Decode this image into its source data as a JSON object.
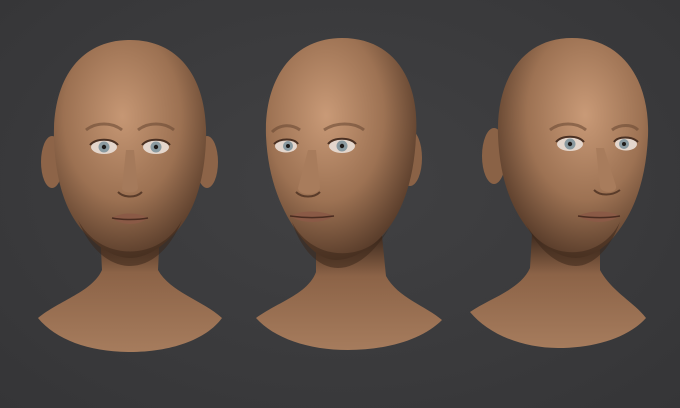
{
  "scene": {
    "background_color": "#3b3b3d",
    "skin_color": "#a47a5c",
    "skin_shadow_color": "#4e3424",
    "iris_color": "#8a9aa0",
    "heads": [
      {
        "view": "front"
      },
      {
        "view": "three-quarter-left"
      },
      {
        "view": "three-quarter-right"
      }
    ]
  }
}
